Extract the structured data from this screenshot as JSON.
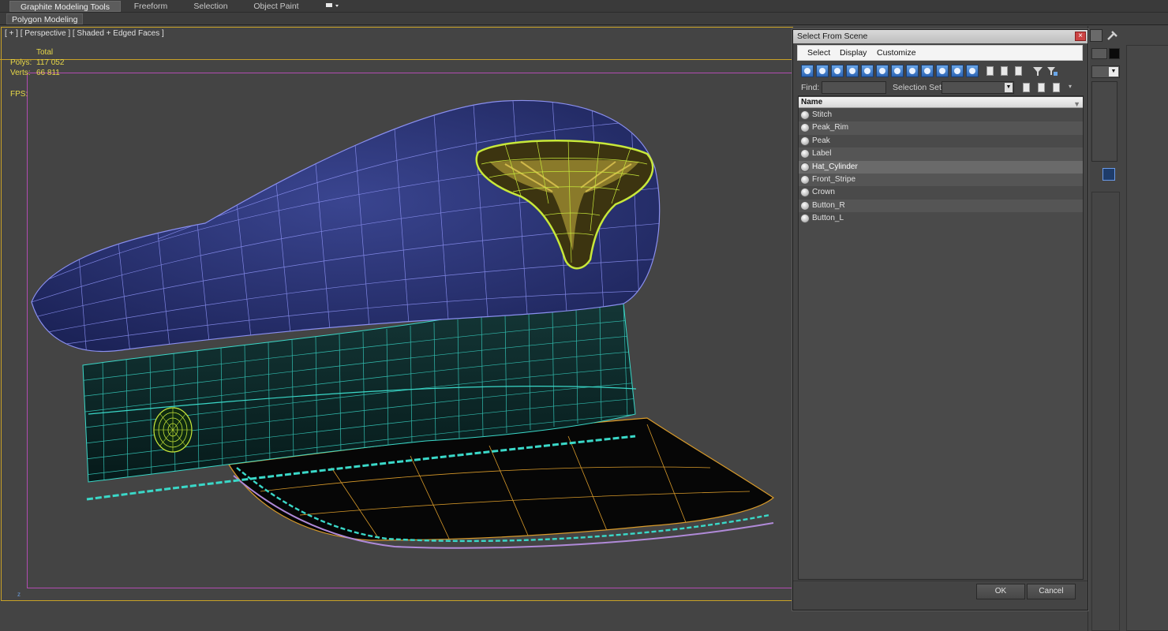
{
  "ribbon": {
    "tabs": [
      "Graphite Modeling Tools",
      "Freeform",
      "Selection",
      "Object Paint"
    ],
    "subtab": "Polygon Modeling"
  },
  "viewport": {
    "label": "[ + ] [ Perspective ] [ Shaded + Edged Faces ]",
    "stats": {
      "total_label": "Total",
      "polys_label": "Polys:",
      "polys_value": "117 052",
      "verts_label": "Verts:",
      "verts_value": "66 811",
      "fps_label": "FPS:"
    },
    "axis_label": "z"
  },
  "dialog": {
    "title": "Select From Scene",
    "menu": [
      "Select",
      "Display",
      "Customize"
    ],
    "find_label": "Find:",
    "find_value": "",
    "selection_set_label": "Selection Set:",
    "selection_set_value": "",
    "column_name": "Name",
    "items": [
      {
        "name": "Stitch",
        "selected": false
      },
      {
        "name": "Peak_Rim",
        "selected": false
      },
      {
        "name": "Peak",
        "selected": false
      },
      {
        "name": "Label",
        "selected": false
      },
      {
        "name": "Hat_Cylinder",
        "selected": true
      },
      {
        "name": "Front_Stripe",
        "selected": false
      },
      {
        "name": "Crown",
        "selected": false
      },
      {
        "name": "Button_R",
        "selected": false
      },
      {
        "name": "Button_L",
        "selected": false
      }
    ],
    "ok_label": "OK",
    "cancel_label": "Cancel"
  },
  "colors": {
    "crown": "#2f3a7a",
    "crown_wire": "#8a8ff0",
    "band": "#0d2a2a",
    "band_wire": "#3ad8c8",
    "peak": "#050505",
    "peak_wire": "#d89a2a",
    "badge_wire": "#c8e83a",
    "safe_frame": "#b24cb2",
    "viewport_border": "#c9a227"
  }
}
